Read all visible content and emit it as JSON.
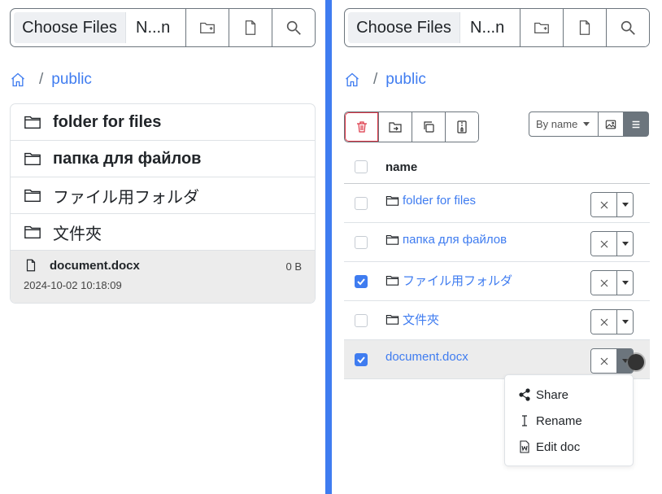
{
  "colors": {
    "accent": "#3f7cf0",
    "danger": "#dc3545",
    "border": "#6c757d",
    "selected_row": "#ececec"
  },
  "left": {
    "toolbar": {
      "choose_label": "Choose Files",
      "file_name": "N...n",
      "icons": [
        "folder-plus-icon",
        "file-icon",
        "search-icon"
      ]
    },
    "breadcrumb": {
      "separator": "/",
      "current": "public"
    },
    "items": [
      {
        "label": "folder for files",
        "bold": true
      },
      {
        "label": "папка для файлов",
        "bold": true
      },
      {
        "label": "ファイル用フォルダ",
        "bold": false
      },
      {
        "label": "文件夾",
        "bold": false
      }
    ],
    "file": {
      "name": "document.docx",
      "size": "0 B",
      "date": "2024-10-02 10:18:09"
    }
  },
  "right": {
    "toolbar": {
      "choose_label": "Choose Files",
      "file_name": "N...n"
    },
    "breadcrumb": {
      "separator": "/",
      "current": "public"
    },
    "actions": [
      "trash-icon",
      "move-icon",
      "copy-icon",
      "zip-icon"
    ],
    "sort": {
      "selected": "By name"
    },
    "table": {
      "header": "name",
      "rows": [
        {
          "name": "folder for files",
          "is_folder": true,
          "checked": false
        },
        {
          "name": "папка для файлов",
          "is_folder": true,
          "checked": false
        },
        {
          "name": "ファイル用フォルダ",
          "is_folder": true,
          "checked": true
        },
        {
          "name": "文件夾",
          "is_folder": true,
          "checked": false
        },
        {
          "name": "document.docx",
          "is_folder": false,
          "checked": true
        }
      ]
    },
    "menu": [
      {
        "label": "Share",
        "icon": "share-icon"
      },
      {
        "label": "Rename",
        "icon": "text-cursor-icon"
      },
      {
        "label": "Edit doc",
        "icon": "word-doc-icon"
      }
    ]
  }
}
